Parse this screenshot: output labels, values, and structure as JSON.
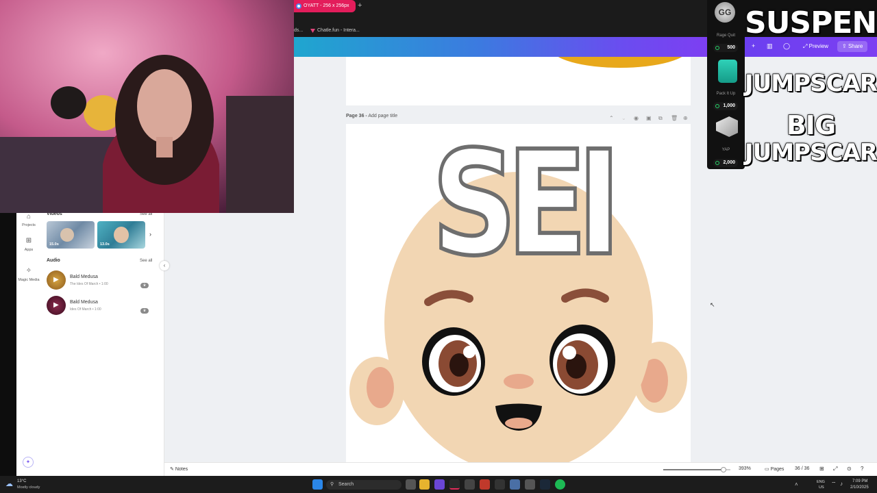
{
  "browser": {
    "active_tab": "OYATT - 256 x 256px",
    "bookmarks": [
      "ds...",
      "Chatle.fun - Intera..."
    ]
  },
  "editor_header": {
    "preview": "Preview",
    "share": "Share"
  },
  "canvas": {
    "page_label": "Page 36 -",
    "page_title_placeholder": "Add page title",
    "graphic_text": "SEI"
  },
  "left_panel": {
    "rail": [
      {
        "label": "Projects",
        "icon": "folder-icon"
      },
      {
        "label": "Apps",
        "icon": "apps-grid-icon"
      },
      {
        "label": "Magic Media",
        "icon": "magic-media-icon"
      }
    ],
    "videos_heading": "Videos",
    "see_all": "See all",
    "videos": [
      {
        "duration": "15.0s"
      },
      {
        "duration": "13.0s"
      }
    ],
    "audio_heading": "Audio",
    "audio": [
      {
        "title": "Bald Medusa",
        "subtitle": "The Ides Of March • 1:00"
      },
      {
        "title": "Bald Medusa",
        "subtitle": "Ides Of March • 1:00"
      }
    ]
  },
  "overlay": {
    "gg": "GG",
    "items": [
      {
        "label": "Rage Quit",
        "cost": "500"
      },
      {
        "label": "Pack It Up",
        "cost": "1,000"
      },
      {
        "label": "YAP",
        "cost": "2,000"
      }
    ],
    "alerts": [
      "SUSPENSE",
      "JUMPSCARE",
      "BIG",
      "JUMPSCARE"
    ]
  },
  "footer": {
    "notes": "Notes",
    "zoom": "393%",
    "pages": "Pages",
    "page_count": "36 / 36",
    "zoom_level": 0.9
  },
  "taskbar": {
    "weather_temp": "13°C",
    "weather_desc": "Mostly cloudy",
    "search": "Search",
    "lang_top": "ENG",
    "lang_bottom": "US",
    "time": "7:09 PM",
    "date": "2/10/2025"
  }
}
